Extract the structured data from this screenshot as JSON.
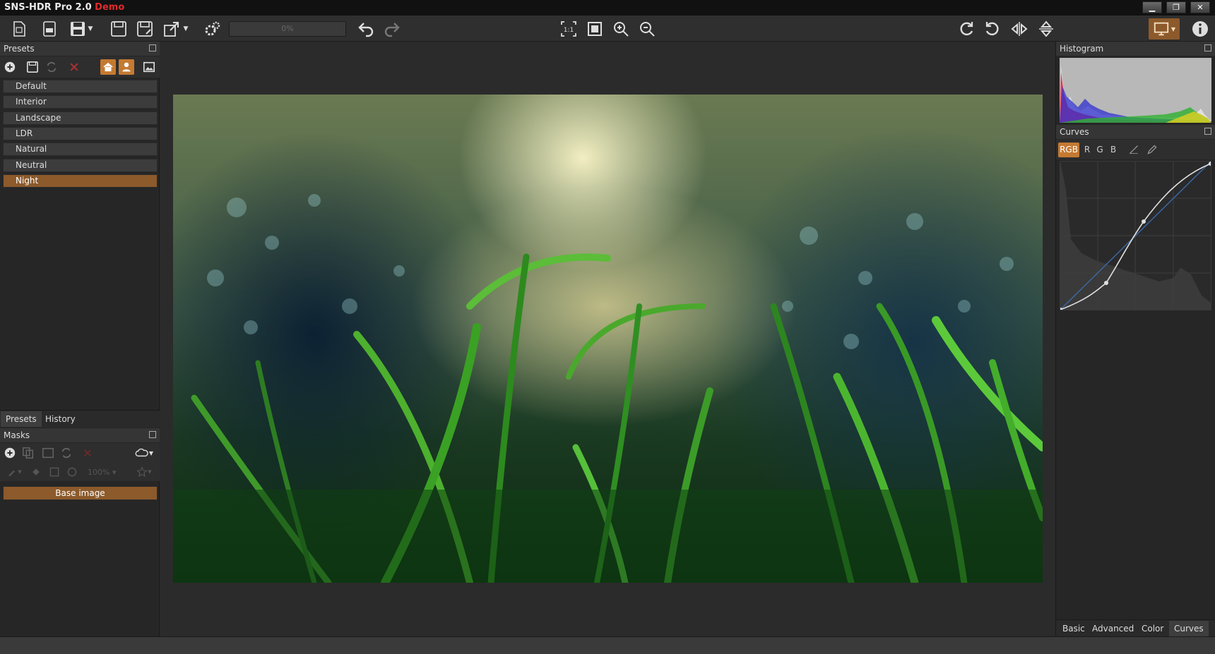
{
  "window": {
    "title": "SNS-HDR Pro 2.0",
    "demo_label": "Demo",
    "controls": [
      "minimize",
      "restore",
      "close"
    ]
  },
  "toolbar": {
    "progress_label": "0%",
    "icons": [
      "new-file-icon",
      "open-sns-icon",
      "save-sns-icon",
      "save-icon",
      "save-as-icon",
      "export-icon",
      "settings-icon",
      "undo-icon",
      "redo-icon",
      "zoom-1-1-icon",
      "fit-icon",
      "zoom-in-icon",
      "zoom-out-icon",
      "rotate-cw-icon",
      "rotate-ccw-icon",
      "flip-horizontal-icon",
      "flip-vertical-icon",
      "display-icon",
      "info-icon"
    ]
  },
  "presets_panel": {
    "title": "Presets",
    "items": [
      {
        "label": "Default"
      },
      {
        "label": "Interior"
      },
      {
        "label": "Landscape"
      },
      {
        "label": "LDR"
      },
      {
        "label": "Natural"
      },
      {
        "label": "Neutral"
      },
      {
        "label": "Night",
        "selected": true
      }
    ],
    "bottom_tabs": [
      {
        "label": "Presets",
        "active": true
      },
      {
        "label": "History",
        "active": false
      }
    ]
  },
  "masks_panel": {
    "title": "Masks",
    "opacity": "100%",
    "base_image_label": "Base image"
  },
  "histogram_panel": {
    "title": "Histogram"
  },
  "curves_panel": {
    "title": "Curves",
    "channels": [
      {
        "label": "RGB",
        "active": true
      },
      {
        "label": "R",
        "active": false
      },
      {
        "label": "G",
        "active": false
      },
      {
        "label": "B",
        "active": false
      }
    ]
  },
  "right_tabs": [
    {
      "label": "Basic",
      "active": false
    },
    {
      "label": "Advanced",
      "active": false
    },
    {
      "label": "Color",
      "active": false
    },
    {
      "label": "Curves",
      "active": true
    }
  ],
  "colors": {
    "accent": "#8c5a2b",
    "demo": "#e02a2a"
  }
}
